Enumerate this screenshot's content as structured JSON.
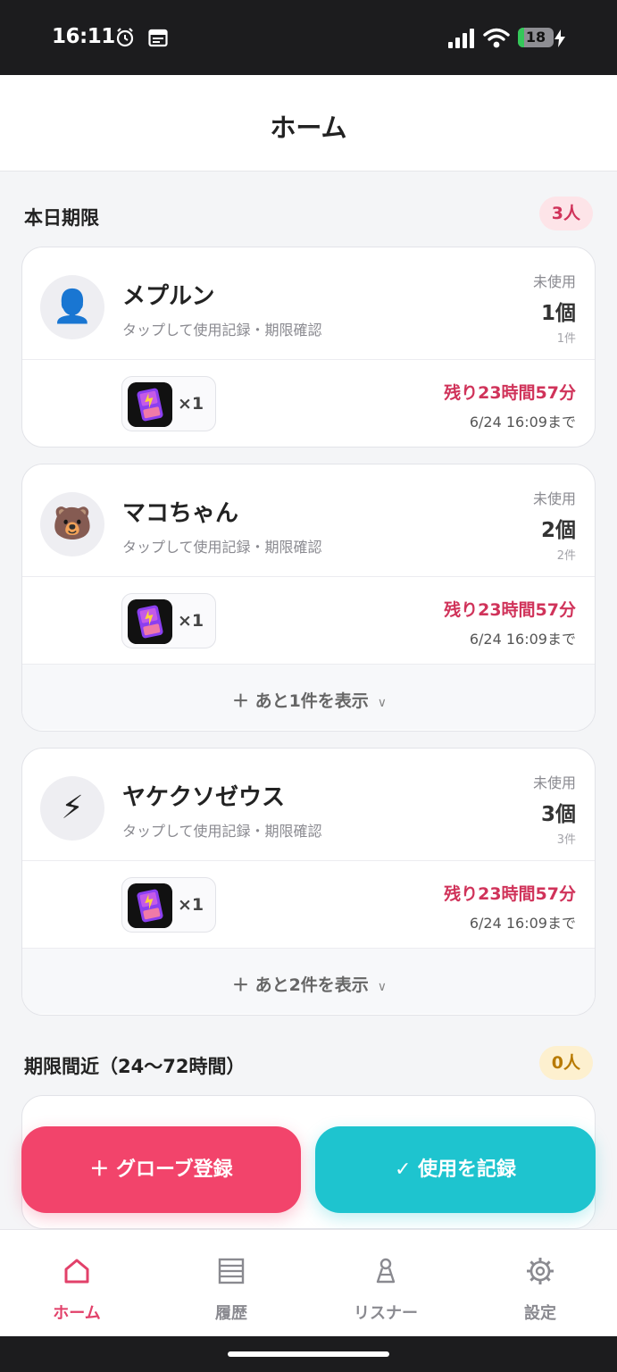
{
  "status_bar": {
    "time": "16:11",
    "battery_level": "18",
    "battery_fraction": 0.18,
    "icons": [
      "alarm-icon",
      "calendar-icon",
      "signal-icon",
      "wifi-icon",
      "battery-icon",
      "charging-icon"
    ]
  },
  "header": {
    "title": "ホーム"
  },
  "sections": {
    "today": {
      "title": "本日期限",
      "count": "3人"
    },
    "soon": {
      "title": "期限間近（24〜72時間）",
      "count": "0人"
    }
  },
  "cards": [
    {
      "avatar_icon": "person-icon",
      "avatar_glyph": "👤",
      "name": "メプルン",
      "hint": "タップして使用記録・期限確認",
      "unused_label": "未使用",
      "unused_count": "1個",
      "unused_sub": "1件",
      "item": {
        "qty": "×1",
        "remaining": "残り23時間57分",
        "deadline": "6/24 16:09まで"
      }
    },
    {
      "avatar_icon": "bear-icon",
      "avatar_glyph": "🐻",
      "name": "マコちゃん",
      "hint": "タップして使用記録・期限確認",
      "unused_label": "未使用",
      "unused_count": "2個",
      "unused_sub": "2件",
      "item": {
        "qty": "×1",
        "remaining": "残り23時間57分",
        "deadline": "6/24 16:09まで"
      },
      "more": "＋ あと1件を表示"
    },
    {
      "avatar_icon": "lightning-icon",
      "avatar_glyph": "⚡",
      "name": "ヤケクソゼウス",
      "hint": "タップして使用記録・期限確認",
      "unused_label": "未使用",
      "unused_count": "3個",
      "unused_sub": "3件",
      "item": {
        "qty": "×1",
        "remaining": "残り23時間57分",
        "deadline": "6/24 16:09まで"
      },
      "more": "＋ あと2件を表示"
    }
  ],
  "actions": {
    "register": "＋ グローブ登録",
    "record": "✓ 使用を記録"
  },
  "tabs": [
    {
      "label": "ホーム",
      "icon": "home-icon",
      "active": true
    },
    {
      "label": "履歴",
      "icon": "list-icon",
      "active": false
    },
    {
      "label": "リスナー",
      "icon": "person-outline-icon",
      "active": false
    },
    {
      "label": "設定",
      "icon": "gear-icon",
      "active": false
    }
  ],
  "colors": {
    "accent_pink": "#f2446b",
    "accent_teal": "#1ec4cf",
    "deadline_red": "#d0335a",
    "active_tab": "#e2416a"
  }
}
